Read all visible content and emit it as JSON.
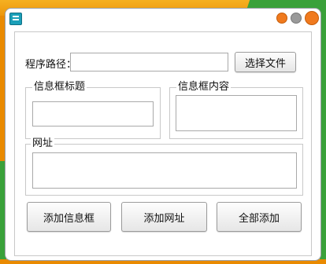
{
  "window": {
    "controls": [
      "minimize",
      "maximize",
      "close"
    ]
  },
  "path_row": {
    "label": "程序路径：",
    "input_value": "",
    "browse_label": "选择文件"
  },
  "groups": {
    "title_group": "信息框标题",
    "content_group": "信息框内容",
    "url_group": "网址"
  },
  "fields": {
    "title_value": "",
    "content_value": "",
    "url_value": ""
  },
  "buttons": {
    "add_info": "添加信息框",
    "add_url": "添加网址",
    "add_all": "全部添加"
  },
  "colors": {
    "accent_orange": "#e98a00",
    "accent_green": "#3aa13a"
  }
}
